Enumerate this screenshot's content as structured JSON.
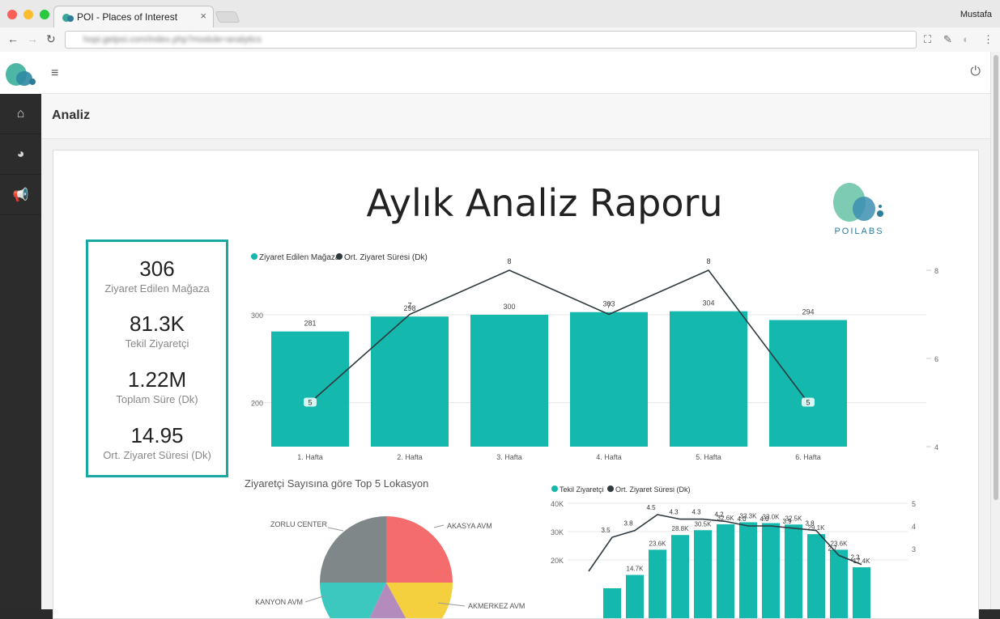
{
  "browser": {
    "tab_title": "POI - Places of Interest",
    "tab_close": "×",
    "user": "Mustafa",
    "url": "hopi.getpoi.com/index.php?module=analytics"
  },
  "topbar": {
    "menu_icon": "≡",
    "power_icon": "⏻"
  },
  "page": {
    "title": "Analiz"
  },
  "report": {
    "title": "Aylık Analiz Raporu",
    "brand": "POILABS",
    "kpis": [
      {
        "value": "306",
        "label": "Ziyaret Edilen Mağaza"
      },
      {
        "value": "81.3K",
        "label": "Tekil Ziyaretçi"
      },
      {
        "value": "1.22M",
        "label": "Toplam Süre (Dk)"
      },
      {
        "value": "14.95",
        "label": "Ort. Ziyaret Süresi (Dk)"
      }
    ],
    "pie_title": "Ziyaretçi Sayısına göre Top 5 Lokasyon"
  },
  "colors": {
    "teal": "#14b8ad",
    "line": "#2f3a3f"
  },
  "chart_data": [
    {
      "type": "bar",
      "categories": [
        "1. Hafta",
        "2. Hafta",
        "3. Hafta",
        "4. Hafta",
        "5. Hafta",
        "6. Hafta"
      ],
      "series": [
        {
          "name": "Ziyaret Edilen Mağaza",
          "values": [
            281,
            298,
            300,
            303,
            304,
            294
          ],
          "axis": "left"
        },
        {
          "name": "Ort. Ziyaret Süresi (Dk)",
          "type": "line",
          "values": [
            5,
            7,
            8,
            7,
            8,
            5
          ],
          "axis": "right"
        }
      ],
      "ylim": [
        150,
        300
      ],
      "yticks": [
        "300",
        "200"
      ],
      "y2lim": [
        4,
        8
      ],
      "y2ticks": [
        "8",
        "6",
        "4"
      ],
      "legend": "top-left"
    },
    {
      "type": "pie",
      "title": "Ziyaretçi Sayısına göre Top 5 Lokasyon",
      "slices": [
        {
          "label": "AKASYA AVM",
          "value": 25,
          "color": "#f46c6c"
        },
        {
          "label": "AKMERKEZ AVM",
          "value": 17,
          "color": "#f4d03f"
        },
        {
          "label": "",
          "value": 15,
          "color": "#b38bbd"
        },
        {
          "label": "KANYON AVM",
          "value": 18,
          "color": "#3cc8bf"
        },
        {
          "label": "ZORLU CENTER",
          "value": 25,
          "color": "#7f8789"
        }
      ]
    },
    {
      "type": "bar",
      "series": [
        {
          "name": "Tekil Ziyaretçi",
          "values": [
            10,
            14.7,
            23.6,
            28.8,
            30.5,
            32.6,
            33.3,
            33.0,
            32.5,
            29.1,
            23.6,
            17.4
          ],
          "labels": [
            "",
            "14.7K",
            "23.6K",
            "28.8K",
            "30.5K",
            "32.6K",
            "33.3K",
            "33.0K",
            "32.5K",
            "29.1K",
            "23.6K",
            "17.4K"
          ],
          "axis": "left"
        },
        {
          "name": "Ort. Ziyaret Süresi (Dk)",
          "type": "line",
          "values": [
            2.0,
            3.5,
            3.8,
            4.5,
            4.3,
            4.3,
            4.2,
            4.0,
            4.0,
            3.9,
            3.8,
            2.7,
            2.3
          ],
          "axis": "right"
        }
      ],
      "ylim": [
        0,
        40
      ],
      "yticks": [
        "40K",
        "30K",
        "20K"
      ],
      "y2lim": [
        0,
        5
      ],
      "y2ticks": [
        "5",
        "4",
        "3"
      ],
      "legend": "top-left"
    }
  ]
}
